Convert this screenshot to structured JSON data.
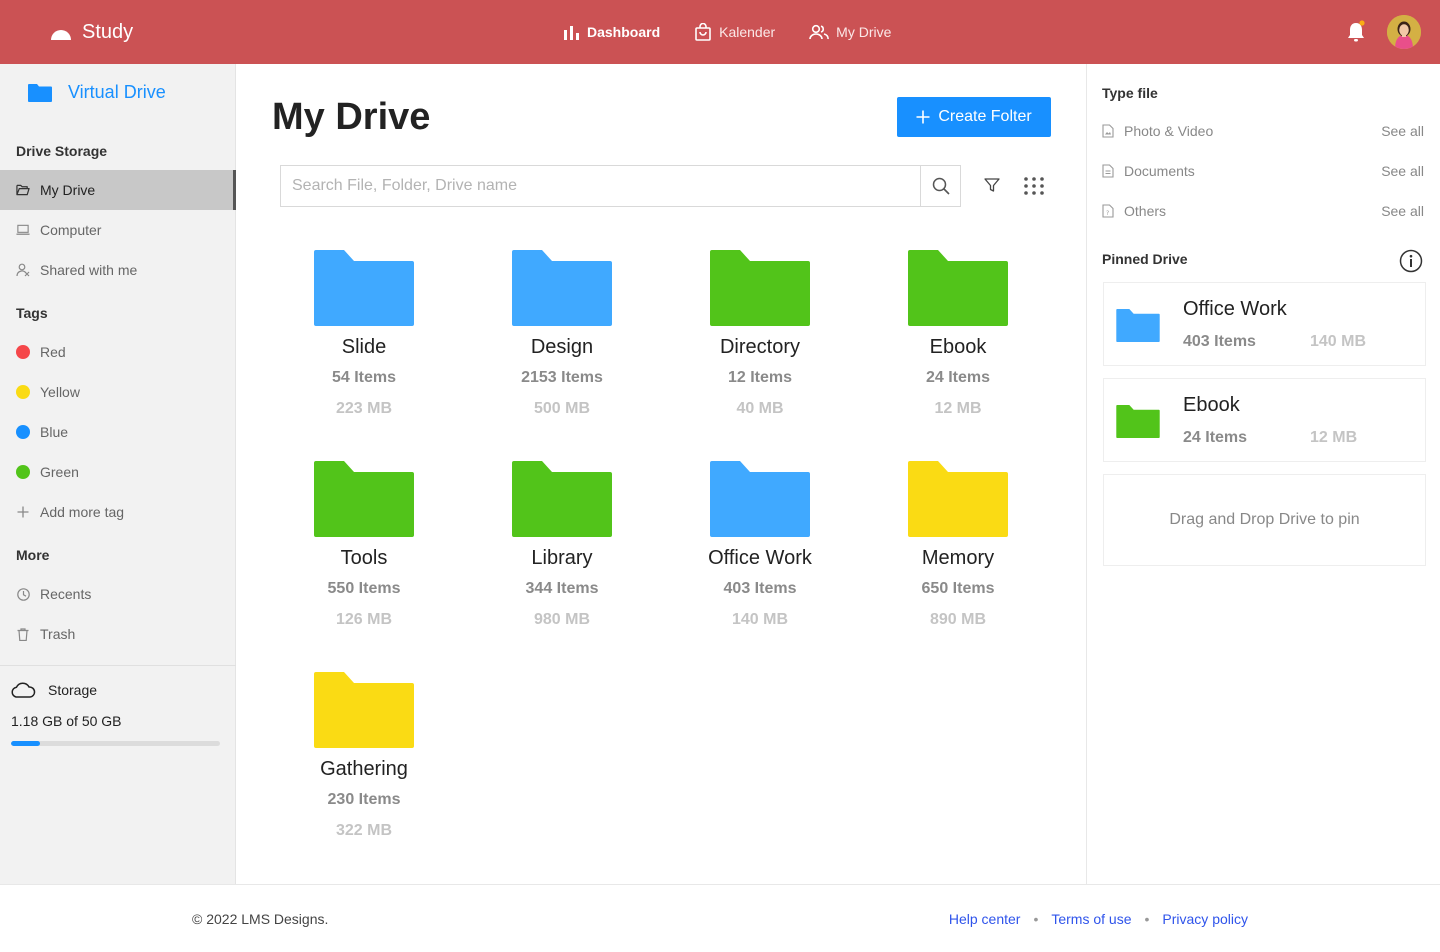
{
  "header": {
    "brand": "Study",
    "nav": [
      {
        "label": "Dashboard",
        "icon": "bar-chart-icon",
        "active": true
      },
      {
        "label": "Kalender",
        "icon": "shopping-bag-icon",
        "active": false
      },
      {
        "label": "My Drive",
        "icon": "users-icon",
        "active": false
      }
    ],
    "notification_dot_color": "#faad14"
  },
  "sidebar": {
    "title": "Virtual Drive",
    "drive_storage_heading": "Drive Storage",
    "drive_items": [
      {
        "label": "My Drive",
        "icon": "folder-open-icon",
        "active": true
      },
      {
        "label": "Computer",
        "icon": "laptop-icon",
        "active": false
      },
      {
        "label": "Shared with me",
        "icon": "shared-user-icon",
        "active": false
      }
    ],
    "tags_heading": "Tags",
    "tags": [
      {
        "label": "Red",
        "color": "#f5474a"
      },
      {
        "label": "Yellow",
        "color": "#fadb14"
      },
      {
        "label": "Blue",
        "color": "#1890ff"
      },
      {
        "label": "Green",
        "color": "#52c41a"
      }
    ],
    "add_tag": "Add more tag",
    "more_heading": "More",
    "more_items": [
      {
        "label": "Recents",
        "icon": "clock-icon"
      },
      {
        "label": "Trash",
        "icon": "trash-icon"
      }
    ],
    "storage": {
      "title": "Storage",
      "usage_text": "1.18 GB of 50 GB",
      "used_fraction": 0.0236
    }
  },
  "main": {
    "title": "My Drive",
    "create_button": "Create Folter",
    "search_placeholder": "Search File, Folder, Drive name",
    "folders": [
      {
        "name": "Slide",
        "items": "54 Items",
        "size": "223 MB",
        "color": "#40a9ff"
      },
      {
        "name": "Design",
        "items": "2153 Items",
        "size": "500 MB",
        "color": "#40a9ff"
      },
      {
        "name": "Directory",
        "items": "12 Items",
        "size": "40 MB",
        "color": "#52c41a"
      },
      {
        "name": "Ebook",
        "items": "24 Items",
        "size": "12 MB",
        "color": "#52c41a"
      },
      {
        "name": "Tools",
        "items": "550 Items",
        "size": "126 MB",
        "color": "#52c41a"
      },
      {
        "name": "Library",
        "items": "344 Items",
        "size": "980 MB",
        "color": "#52c41a"
      },
      {
        "name": "Office Work",
        "items": "403 Items",
        "size": "140 MB",
        "color": "#40a9ff"
      },
      {
        "name": "Memory",
        "items": "650 Items",
        "size": "890 MB",
        "color": "#fadb14"
      },
      {
        "name": "Gathering",
        "items": "230 Items",
        "size": "322 MB",
        "color": "#fadb14"
      }
    ]
  },
  "right_panel": {
    "type_file_heading": "Type file",
    "types": [
      {
        "label": "Photo & Video",
        "action": "See all"
      },
      {
        "label": "Documents",
        "action": "See all"
      },
      {
        "label": "Others",
        "action": "See all"
      }
    ],
    "pinned_heading": "Pinned Drive",
    "pinned": [
      {
        "name": "Office Work",
        "items": "403 Items",
        "size": "140 MB",
        "color": "#40a9ff"
      },
      {
        "name": "Ebook",
        "items": "24 Items",
        "size": "12 MB",
        "color": "#52c41a"
      }
    ],
    "drop_text": "Drag and Drop Drive to pin"
  },
  "footer": {
    "copyright": "© 2022 LMS Designs.",
    "links": [
      "Help center",
      "Terms of use",
      "Privacy policy"
    ]
  }
}
